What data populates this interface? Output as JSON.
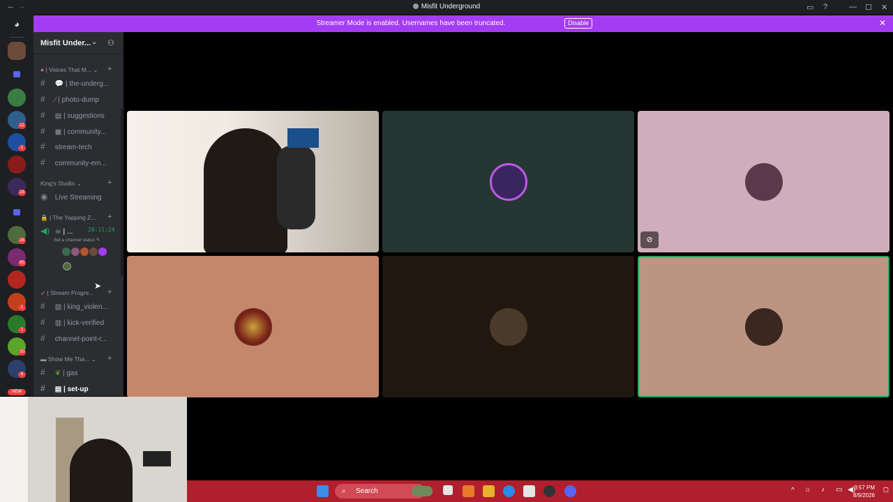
{
  "window": {
    "title": "Misfit Underground",
    "back": "←",
    "forward": "→"
  },
  "banner": {
    "message": "Streamer Mode is enabled. Usernames have been truncated.",
    "button": "Disable",
    "close": "✕"
  },
  "server": {
    "name": "Misfit Under...",
    "chevron": "⌄"
  },
  "sidebar": {
    "categories": {
      "voices": "| Voices That M...",
      "kings": "King's Studio",
      "yapping": "| The Yapping Z...",
      "stream": "| Stream Progre...",
      "show": "Show Me Tha..."
    },
    "channels": [
      "| the-underg...",
      "| photo-dump",
      "| suggestions",
      "| community...",
      "stream-tech",
      "community-em...",
      "Live Streaming",
      "| king_violen...",
      "| kick-verified",
      "channel-point-r...",
      "| gas",
      "| set-up"
    ],
    "voice_user": {
      "name": "| ...",
      "timer": "20:11:24",
      "status_hint": "Set a channel status"
    }
  },
  "server_badges": [
    "12",
    "1",
    "18",
    "28",
    "90",
    "1",
    "1",
    "30",
    "6",
    "NEW"
  ],
  "taskbar": {
    "search": "Search",
    "time": "3:57 PM",
    "date": "8/9/2026"
  },
  "colors": {
    "banner": "#a33cf2",
    "taskbar": "#b01f2d",
    "speaking": "#23a55a"
  }
}
